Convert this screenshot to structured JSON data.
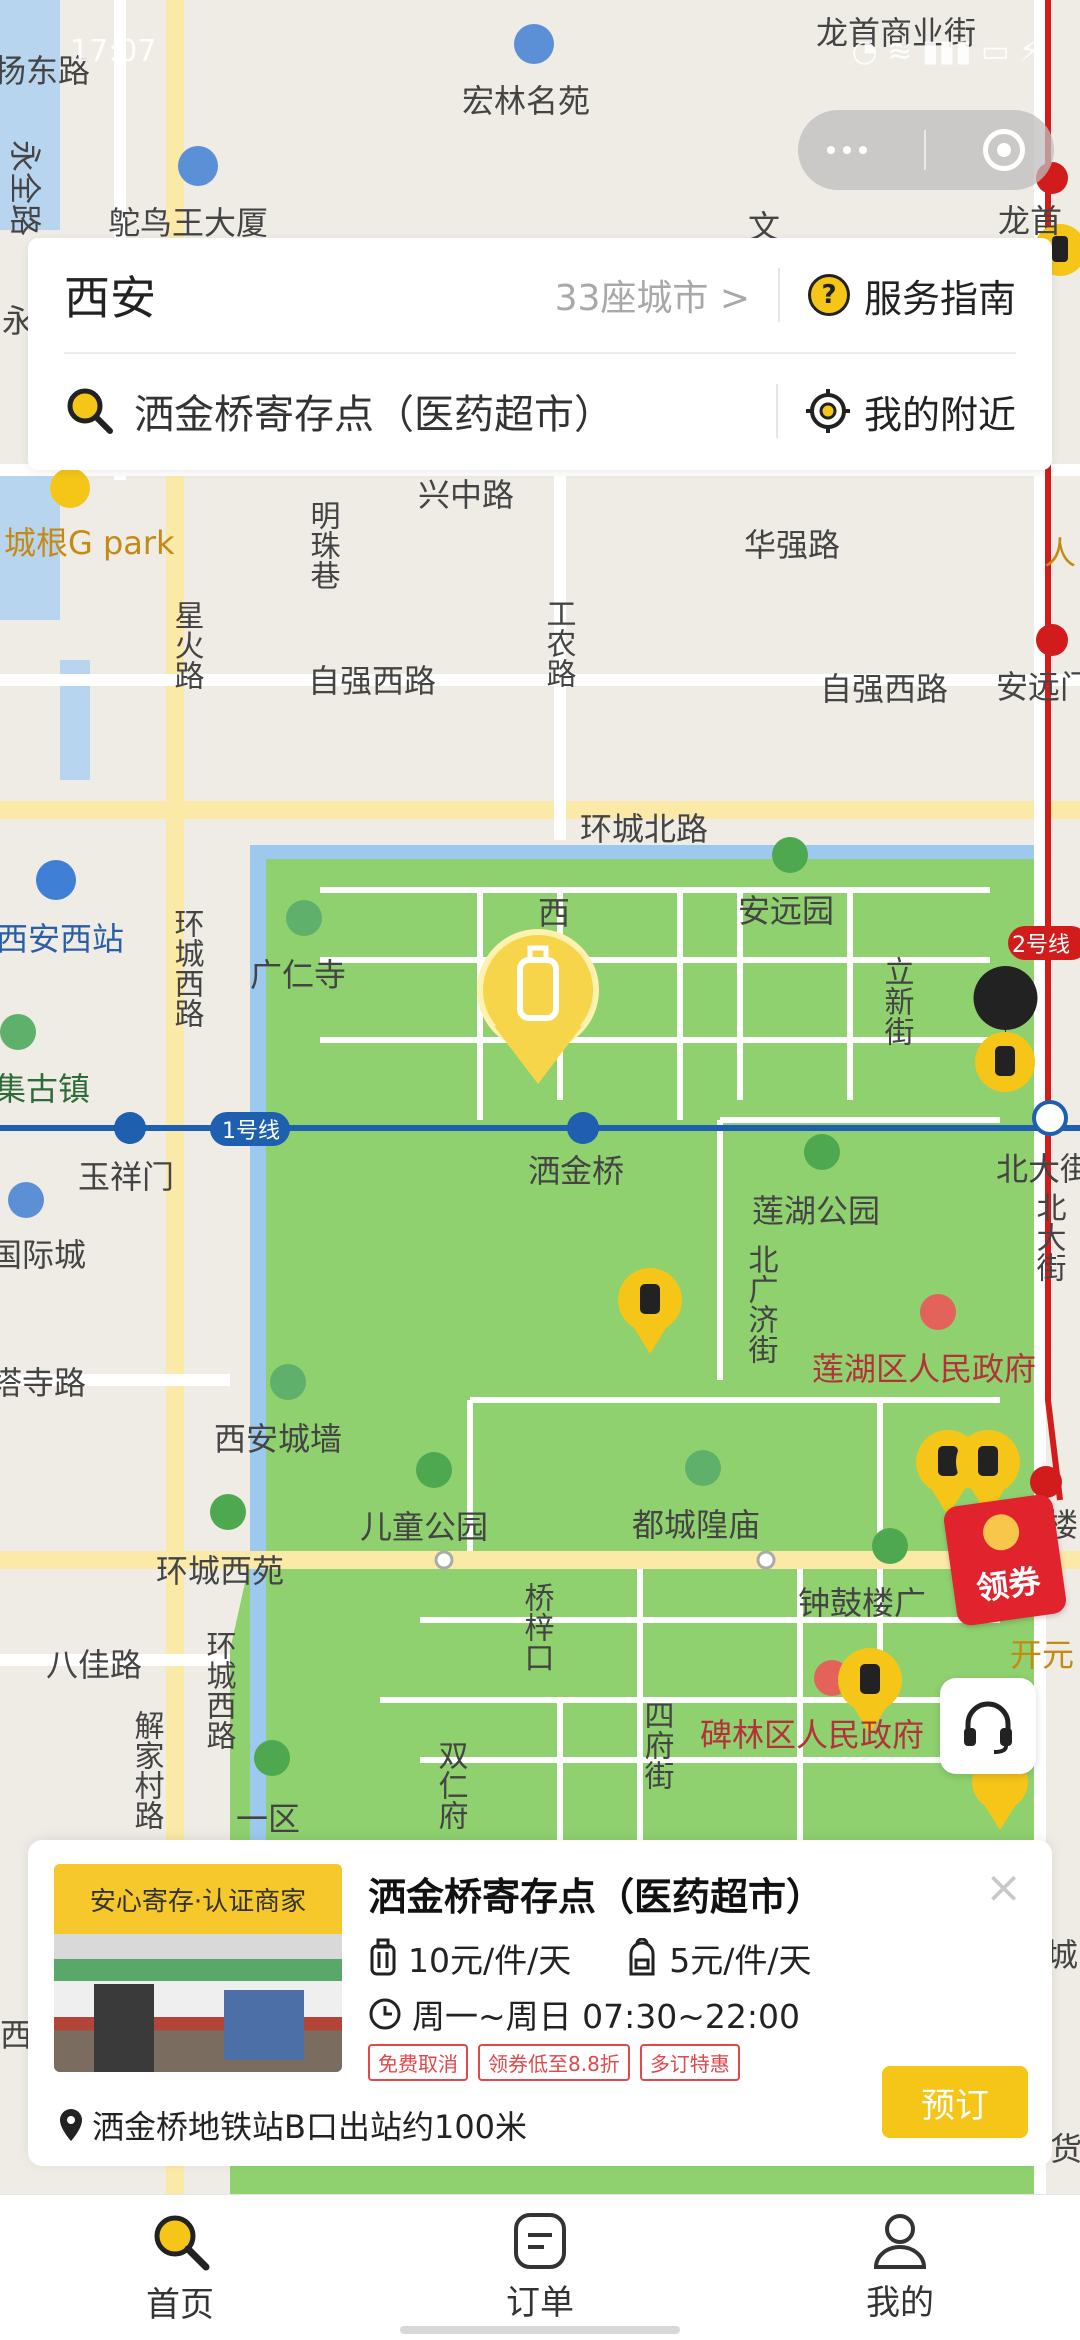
{
  "status_bar": {
    "time": "17:07"
  },
  "header": {
    "city": "西安",
    "cities_link": "33座城市 >",
    "guide_label": "服务指南",
    "search_value": "洒金桥寄存点（医药超市）",
    "nearby_label": "我的附近"
  },
  "map": {
    "labels": {
      "l1": "宏林名苑",
      "l2": "龙首商业街",
      "l3": "扬东路",
      "l4": "永全路",
      "l5": "鸵鸟王大厦",
      "l6": "文",
      "l7": "龙首",
      "l8": "永",
      "l9": "兴中路",
      "l10": "城根G park",
      "l11": "明珠巷",
      "l12": "华强路",
      "l13": "星火路",
      "l14": "工农路",
      "l15": "自强西路",
      "l16": "自强西路",
      "l17": "安远门",
      "l18": "人",
      "l19": "环城北路",
      "l20": "安远园",
      "l21": "西安西站",
      "l22": "广仁寺",
      "l23": "西",
      "l24": "立新街",
      "l25": "2号线",
      "l26": "环城西路",
      "l27": "集古镇",
      "l28": "1号线",
      "l29": "玉祥门",
      "l30": "洒金桥",
      "l31": "北大街",
      "l32": "莲湖公园",
      "l33": "北大街",
      "l34": "国际城",
      "l35": "北广济街",
      "l36": "莲湖区人民政府",
      "l37": "塔寺路",
      "l38": "西安城墙",
      "l39": "儿童公园",
      "l40": "都城隍庙",
      "l41": "环城西苑",
      "l42": "钟鼓楼广",
      "l43": "楼",
      "l44": "八佳路",
      "l45": "环城西路",
      "l46": "桥梓口",
      "l47": "解家村路",
      "l48": "双仁府",
      "l49": "四府街",
      "l50": "碑林区人民政府",
      "l51": "一区",
      "l52": "开元",
      "l53": "城",
      "l54": "西",
      "l55": "货"
    }
  },
  "coupon": {
    "label": "领券"
  },
  "store_card": {
    "badge": "安心寄存·认证商家",
    "title": "洒金桥寄存点（医药超市）",
    "price_luggage": "10元/件/天",
    "price_bag": "5元/件/天",
    "hours": "周一~周日 07:30~22:00",
    "tags": [
      "免费取消",
      "领券低至8.8折",
      "多订特惠"
    ],
    "address": "洒金桥地铁站B口出站约100米",
    "book_label": "预订",
    "close_symbol": "×"
  },
  "tabbar": {
    "home": "首页",
    "orders": "订单",
    "mine": "我的"
  },
  "colors": {
    "accent": "#f5c518",
    "park": "#8fd16f",
    "water": "#9ec9ee",
    "road_main": "#fbe9a7",
    "metro_line1": "#1f5fb0",
    "metro_line2": "#d21c1c"
  }
}
